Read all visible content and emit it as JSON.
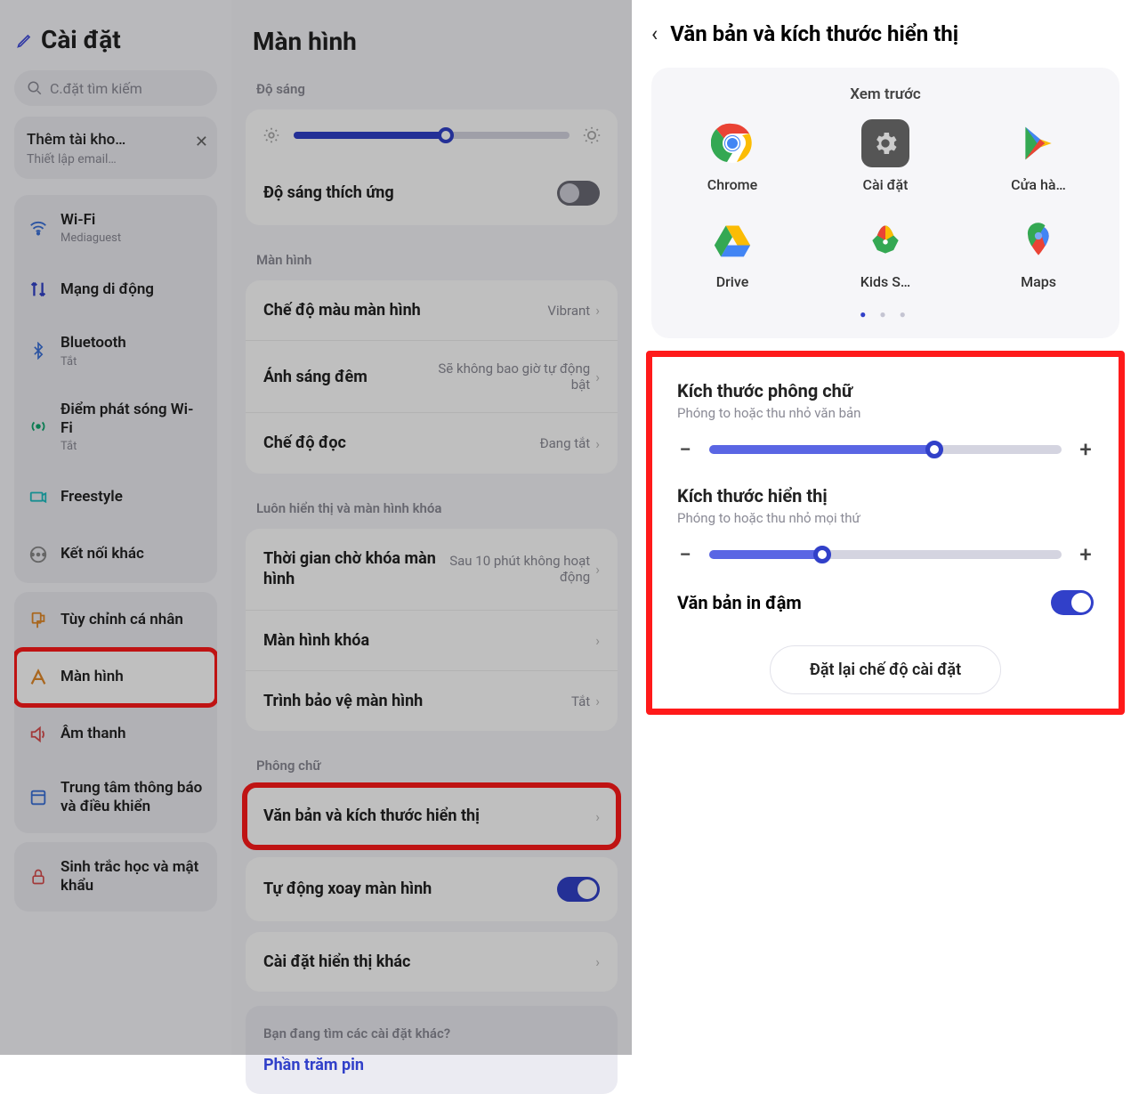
{
  "left": {
    "title": "Cài đặt",
    "search_placeholder": "C.đặt tìm kiếm",
    "account": {
      "line1": "Thêm tài kho…",
      "line2": "Thiết lập email…"
    },
    "group1": [
      {
        "icon": "wifi",
        "label": "Wi-Fi",
        "sub": "Mediaguest"
      },
      {
        "icon": "mobile-data",
        "label": "Mạng di động",
        "sub": ""
      },
      {
        "icon": "bluetooth",
        "label": "Bluetooth",
        "sub": "Tắt"
      },
      {
        "icon": "hotspot",
        "label": "Điểm phát sóng Wi-Fi",
        "sub": "Tắt"
      },
      {
        "icon": "freestyle",
        "label": "Freestyle",
        "sub": ""
      },
      {
        "icon": "other-conn",
        "label": "Kết nối khác",
        "sub": ""
      }
    ],
    "group2": [
      {
        "icon": "personalize",
        "label": "Tùy chỉnh cá nhân",
        "sub": ""
      },
      {
        "icon": "display",
        "label": "Màn hình",
        "sub": "",
        "selected": true
      },
      {
        "icon": "sound",
        "label": "Âm thanh",
        "sub": ""
      },
      {
        "icon": "notifications",
        "label": "Trung tâm thông báo và điều khiển",
        "sub": ""
      }
    ],
    "group3": [
      {
        "icon": "security",
        "label": "Sinh trắc học và mật khẩu",
        "sub": ""
      }
    ]
  },
  "mid": {
    "title": "Màn hình",
    "sect_brightness": "Độ sáng",
    "adaptive_label": "Độ sáng thích ứng",
    "sect_display": "Màn hình",
    "color_mode": {
      "label": "Chế độ màu màn hình",
      "value": "Vibrant"
    },
    "night_light": {
      "label": "Ánh sáng đêm",
      "value": "Sẽ không bao giờ tự động bật"
    },
    "read_mode": {
      "label": "Chế độ đọc",
      "value": "Đang tắt"
    },
    "sect_aod": "Luôn hiển thị và màn hình khóa",
    "timeout": {
      "label": "Thời gian chờ khóa màn hình",
      "value": "Sau 10 phút không hoạt động"
    },
    "lockscreen": {
      "label": "Màn hình khóa"
    },
    "screensaver": {
      "label": "Trình bảo vệ màn hình",
      "value": "Tắt"
    },
    "sect_font": "Phông chữ",
    "text_size": {
      "label": "Văn bản và kích thước hiển thị"
    },
    "autorotate": {
      "label": "Tự động xoay màn hình"
    },
    "other_display": {
      "label": "Cài đặt hiển thị khác"
    },
    "more_q": "Bạn đang tìm các cài đặt khác?",
    "more_link": "Phần trăm pin"
  },
  "right": {
    "title": "Văn bản và kích thước hiển thị",
    "preview_label": "Xem trước",
    "apps": [
      {
        "name": "Chrome",
        "color": "chrome"
      },
      {
        "name": "Cài đặt",
        "color": "settings"
      },
      {
        "name": "Cửa hà…",
        "color": "playstore"
      },
      {
        "name": "Drive",
        "color": "drive"
      },
      {
        "name": "Kids S…",
        "color": "kids"
      },
      {
        "name": "Maps",
        "color": "maps"
      }
    ],
    "font_size": {
      "title": "Kích thước phông chữ",
      "sub": "Phóng to hoặc thu nhỏ văn bản",
      "value_pct": 64
    },
    "display_size": {
      "title": "Kích thước hiển thị",
      "sub": "Phóng to hoặc thu nhỏ mọi thứ",
      "value_pct": 32
    },
    "bold_text": {
      "title": "Văn bản in đậm",
      "on": true
    },
    "reset": "Đặt lại chế độ cài đặt"
  }
}
